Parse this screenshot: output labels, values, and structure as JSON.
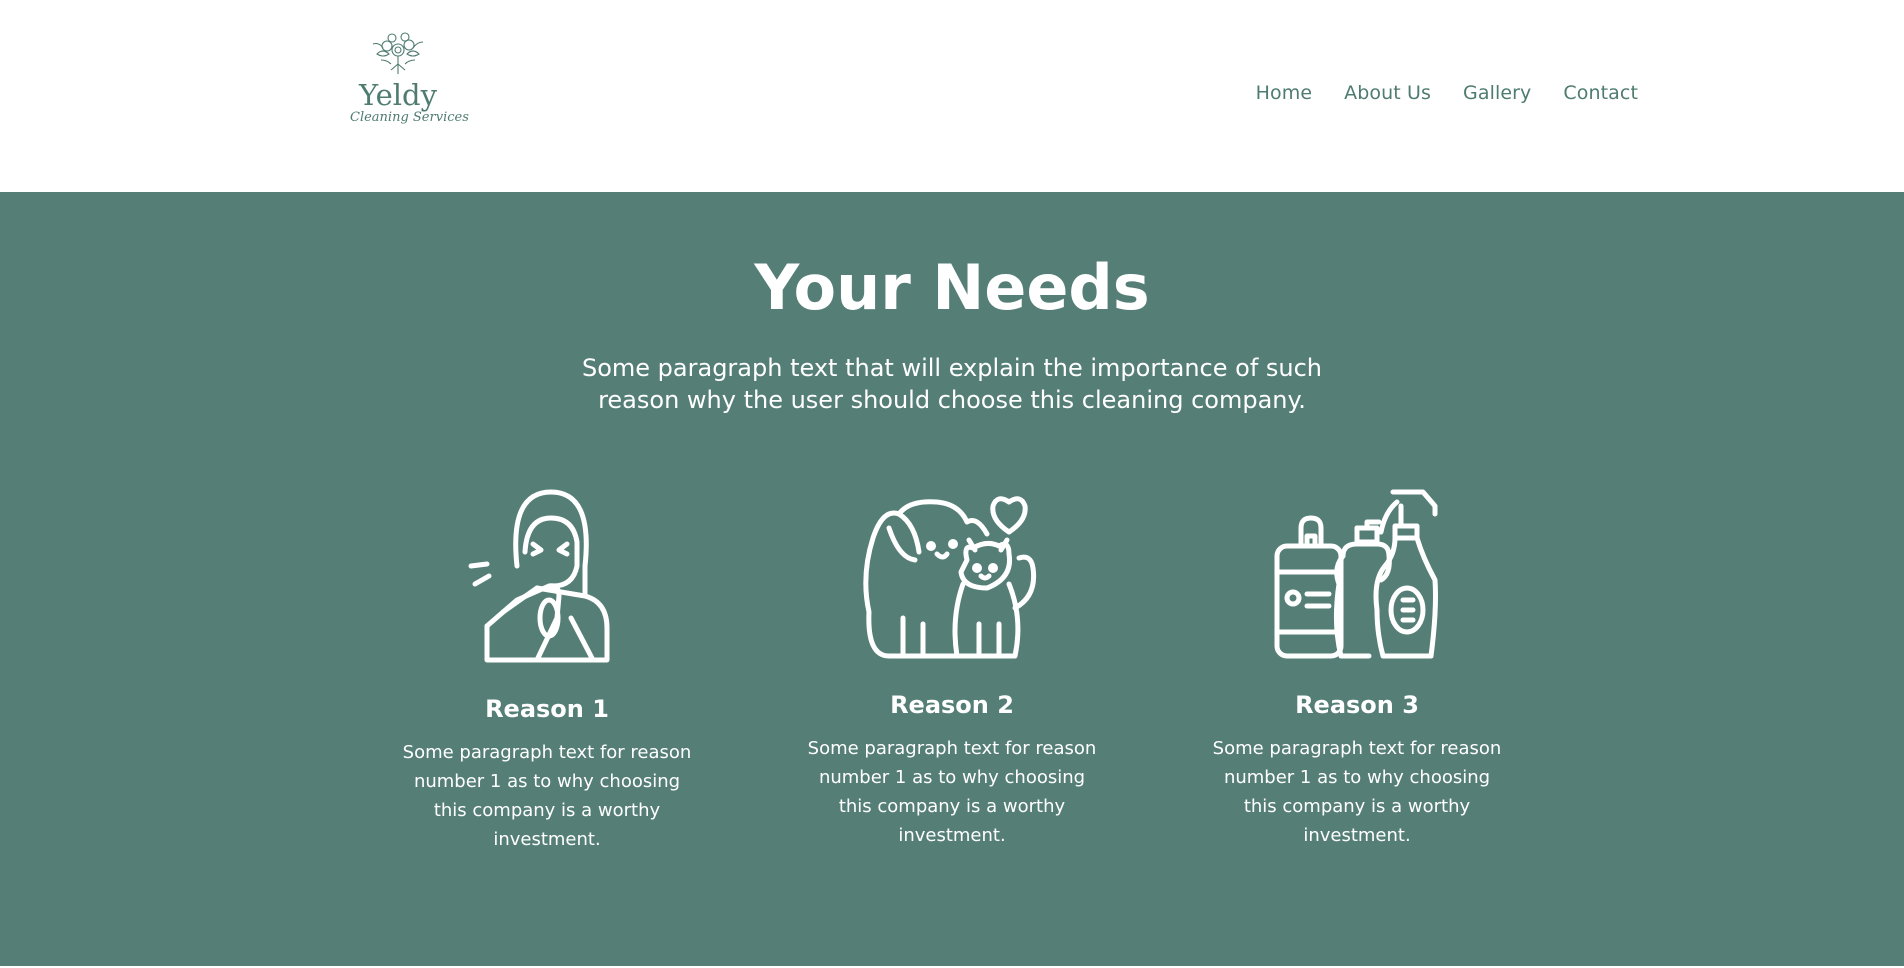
{
  "brand": {
    "name": "Yeldy",
    "tagline": "Cleaning Services",
    "logo_icon": "floral-bouquet-icon",
    "accent_color": "#557f76",
    "text_color": "#4f7c70"
  },
  "nav": {
    "items": [
      {
        "label": "Home"
      },
      {
        "label": "About Us"
      },
      {
        "label": "Gallery"
      },
      {
        "label": "Contact"
      }
    ]
  },
  "needs": {
    "title": "Your Needs",
    "intro": "Some paragraph text that will explain the importance of such reason why the user should choose this cleaning company.",
    "reasons": [
      {
        "icon": "sneezing-person-icon",
        "title": "Reason 1",
        "text": "Some paragraph text for reason number 1 as to why choosing this company is a worthy investment."
      },
      {
        "icon": "pets-dog-cat-icon",
        "title": "Reason 2",
        "text": "Some paragraph text for reason number 1 as to why choosing this company is a worthy investment."
      },
      {
        "icon": "cleaning-products-icon",
        "title": "Reason 3",
        "text": "Some paragraph text for reason number 1 as to why choosing this company is a worthy investment."
      }
    ]
  }
}
